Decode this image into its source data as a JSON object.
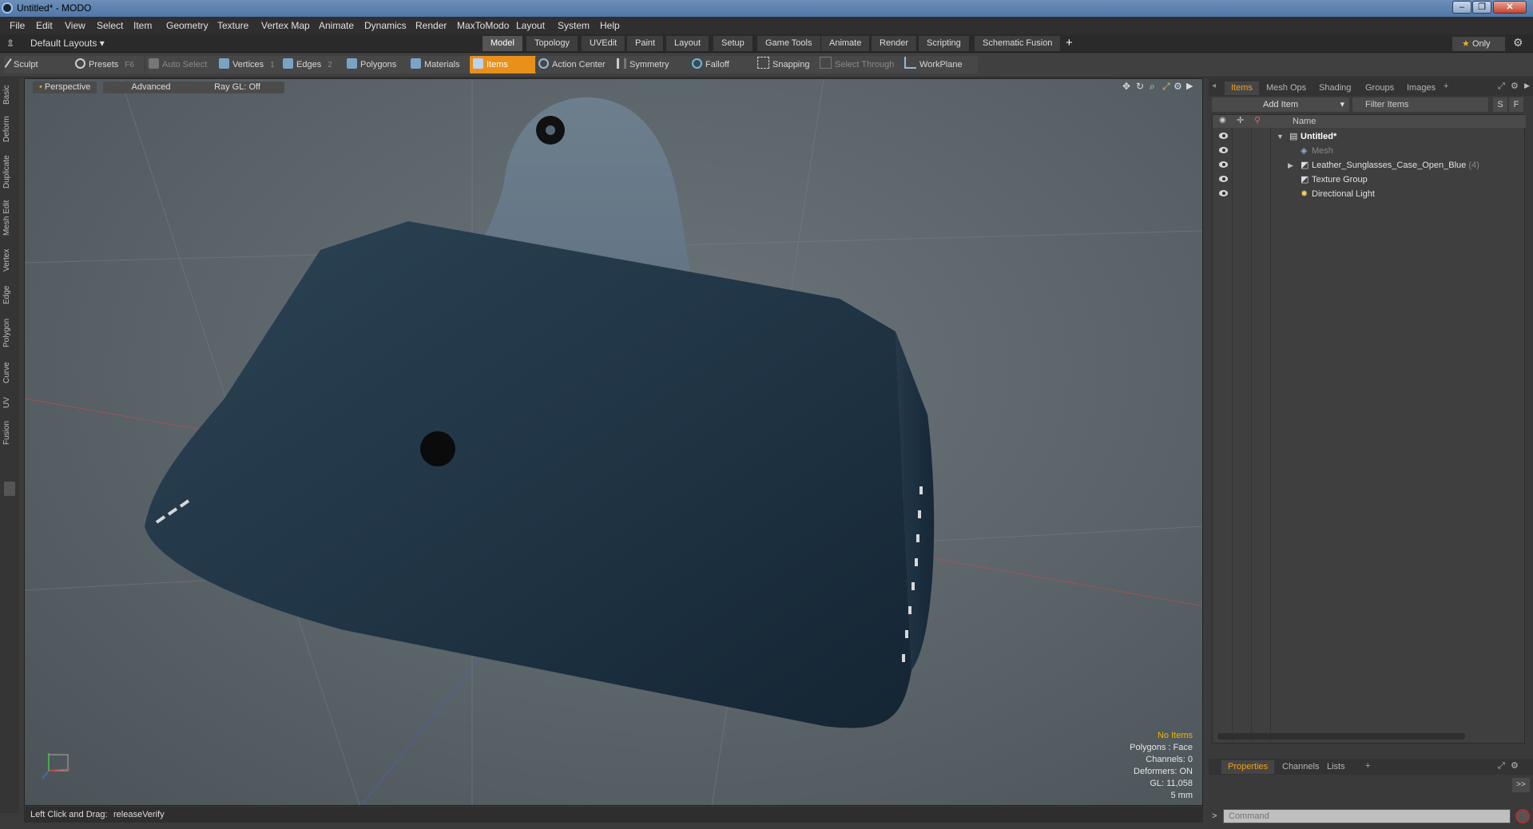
{
  "window": {
    "title": "Untitled* - MODO",
    "minimize": "–",
    "maximize": "❐",
    "close": "✕"
  },
  "menu": [
    "File",
    "Edit",
    "View",
    "Select",
    "Item",
    "Geometry",
    "Texture",
    "Vertex Map",
    "Animate",
    "Dynamics",
    "Render",
    "MaxToModo",
    "Layout",
    "System",
    "Help"
  ],
  "layout_bar": {
    "layouts_label": "Default Layouts",
    "tabs": [
      "Model",
      "Topology",
      "UVEdit",
      "Paint",
      "Layout",
      "Setup",
      "Game Tools",
      "Animate",
      "Render",
      "Scripting",
      "Schematic Fusion"
    ],
    "active_tab": "Model",
    "add": "+",
    "only_label": "Only"
  },
  "toolbar": {
    "sculpt": "Sculpt",
    "presets": "Presets",
    "presets_key": "F6",
    "auto_select": "Auto Select",
    "vertices": "Vertices",
    "vertices_key": "1",
    "edges": "Edges",
    "edges_key": "2",
    "polygons": "Polygons",
    "materials": "Materials",
    "items": "Items",
    "action_center": "Action Center",
    "symmetry": "Symmetry",
    "falloff": "Falloff",
    "snapping": "Snapping",
    "select_through": "Select Through",
    "workplane": "WorkPlane",
    "accent": "#e8901a"
  },
  "left_tabs": [
    "Basic",
    "Deform",
    "Duplicate",
    "Mesh Edit",
    "Vertex",
    "Edge",
    "Polygon",
    "Curve",
    "UV",
    "Fusion"
  ],
  "viewport": {
    "view": "Perspective",
    "shading": "Advanced",
    "raygl": "Ray GL: Off",
    "stats": {
      "items": "No Items",
      "polygons": "Polygons : Face",
      "channels": "Channels: 0",
      "deformers": "Deformers: ON",
      "gl": "GL: 11,058",
      "scale": "5 mm"
    }
  },
  "status": {
    "hint_label": "Left Click and Drag:",
    "hint_value": "releaseVerify"
  },
  "right_panel": {
    "tabs": [
      "Items",
      "Mesh Ops",
      "Shading",
      "Groups",
      "Images"
    ],
    "active_tab": "Items",
    "add_item": "Add Item",
    "filter": "Filter Items",
    "s_btn": "S",
    "f_btn": "F",
    "column_name": "Name",
    "tree": [
      {
        "label": "Untitled*",
        "bold": true
      },
      {
        "label": "Mesh",
        "dim": true
      },
      {
        "label": "Leather_Sunglasses_Case_Open_Blue",
        "count": "(4)"
      },
      {
        "label": "Texture Group"
      },
      {
        "label": "Directional Light"
      }
    ],
    "bottom_tabs": [
      "Properties",
      "Channels",
      "Lists"
    ],
    "bottom_active": "Properties",
    "expand": ">>",
    "command_placeholder": "Command"
  }
}
